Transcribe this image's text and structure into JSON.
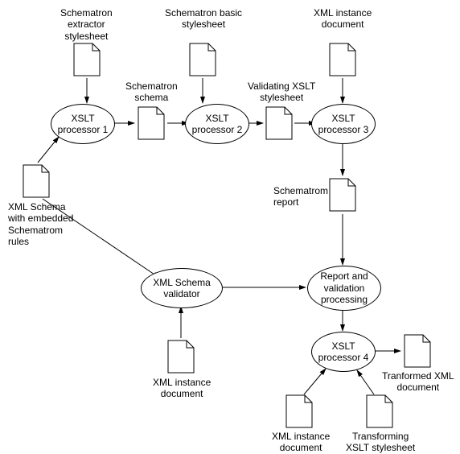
{
  "labels": {
    "schematron_extractor": "Schematron\nextractor\nstylesheet",
    "schematron_basic": "Schematron basic\nstylesheet",
    "xml_instance_top": "XML instance\ndocument",
    "schematron_schema": "Schematron\nschema",
    "validating_xslt": "Validating XSLT\nstylesheet",
    "xml_schema_embedded": "XML Schema\nwith embedded\nSchematrom\nrules",
    "schematrom_report": "Schematrom\nreport",
    "xml_instance_mid": "XML instance\ndocument",
    "xml_instance_bottom": "XML instance\ndocument",
    "transforming_xslt": "Transforming\nXSLT stylesheet",
    "transformed_xml": "Tranformed XML\ndocument"
  },
  "nodes": {
    "xslt1": "XSLT\nprocessor 1",
    "xslt2": "XSLT\nprocessor 2",
    "xslt3": "XSLT\nprocessor 3",
    "xslt4": "XSLT\nprocessor 4",
    "xml_schema_validator": "XML Schema\nvalidator",
    "report_processing": "Report and\nvalidation\nprocessing"
  }
}
